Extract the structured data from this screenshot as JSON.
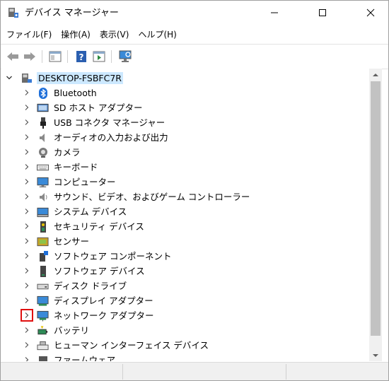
{
  "window": {
    "title": "デバイス マネージャー"
  },
  "menu": [
    "ファイル(F)",
    "操作(A)",
    "表示(V)",
    "ヘルプ(H)"
  ],
  "toolbar": [
    "back",
    "forward",
    "properties-pane",
    "help",
    "run-action",
    "scan-hardware"
  ],
  "tree": {
    "root": "DESKTOP-FSBFC7R",
    "items": [
      {
        "label": "Bluetooth",
        "icon": "bluetooth-icon"
      },
      {
        "label": "SD ホスト アダプター",
        "icon": "sd-host-icon"
      },
      {
        "label": "USB コネクタ マネージャー",
        "icon": "usb-connector-icon"
      },
      {
        "label": "オーディオの入力および出力",
        "icon": "speaker-icon"
      },
      {
        "label": "カメラ",
        "icon": "camera-icon"
      },
      {
        "label": "キーボード",
        "icon": "keyboard-icon"
      },
      {
        "label": "コンピューター",
        "icon": "monitor-icon"
      },
      {
        "label": "サウンド、ビデオ、およびゲーム コントローラー",
        "icon": "sound-icon"
      },
      {
        "label": "システム デバイス",
        "icon": "system-device-icon"
      },
      {
        "label": "セキュリティ デバイス",
        "icon": "security-device-icon"
      },
      {
        "label": "センサー",
        "icon": "sensor-icon"
      },
      {
        "label": "ソフトウェア コンポーネント",
        "icon": "software-component-icon"
      },
      {
        "label": "ソフトウェア デバイス",
        "icon": "software-device-icon"
      },
      {
        "label": "ディスク ドライブ",
        "icon": "disk-drive-icon"
      },
      {
        "label": "ディスプレイ アダプター",
        "icon": "display-adapter-icon"
      },
      {
        "label": "ネットワーク アダプター",
        "icon": "network-adapter-icon",
        "highlighted": true
      },
      {
        "label": "バッテリ",
        "icon": "battery-icon"
      },
      {
        "label": "ヒューマン インターフェイス デバイス",
        "icon": "hid-icon"
      },
      {
        "label": "ファームウェア",
        "icon": "firmware-icon"
      }
    ]
  },
  "colors": {
    "selection": "#cce8ff",
    "highlight_box": "#e01010",
    "accent": "#1e90ff"
  }
}
